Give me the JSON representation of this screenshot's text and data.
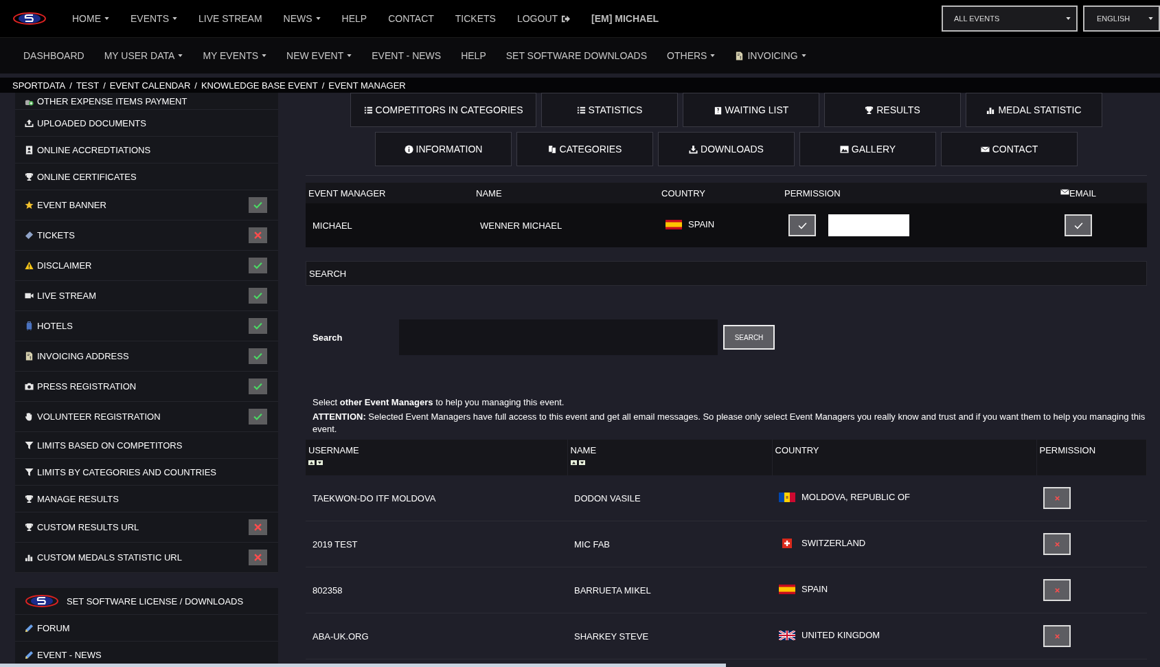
{
  "top_nav": {
    "items": [
      {
        "label": "HOME",
        "dropdown": true
      },
      {
        "label": "EVENTS",
        "dropdown": true
      },
      {
        "label": "LIVE STREAM",
        "dropdown": false
      },
      {
        "label": "NEWS",
        "dropdown": true
      },
      {
        "label": "HELP",
        "dropdown": false
      },
      {
        "label": "CONTACT",
        "dropdown": false
      },
      {
        "label": "TICKETS",
        "dropdown": false
      },
      {
        "label": "LOGOUT",
        "dropdown": false
      }
    ],
    "user": "[EM] MICHAEL",
    "event_select": "ALL EVENTS",
    "language": "ENGLISH"
  },
  "sub_nav": {
    "items": [
      {
        "label": "DASHBOARD",
        "dropdown": false
      },
      {
        "label": "MY USER DATA",
        "dropdown": true
      },
      {
        "label": "MY EVENTS",
        "dropdown": true
      },
      {
        "label": "NEW EVENT",
        "dropdown": true
      },
      {
        "label": "EVENT - NEWS",
        "dropdown": false
      },
      {
        "label": "HELP",
        "dropdown": false
      },
      {
        "label": "SET SOFTWARE DOWNLOADS",
        "dropdown": false
      },
      {
        "label": "OTHERS",
        "dropdown": true
      },
      {
        "label": "INVOICING",
        "dropdown": true
      }
    ]
  },
  "breadcrumb": [
    {
      "label": "SPORTDATA",
      "separator": "/"
    },
    {
      "label": "TEST",
      "separator": "/"
    },
    {
      "label": "EVENT CALENDAR",
      "separator": "/"
    },
    {
      "label": "KNOWLEDGE BASE EVENT",
      "separator": "/"
    },
    {
      "label": "EVENT MANAGER"
    }
  ],
  "sidebar": {
    "items": [
      {
        "label": "OTHER EXPENSE ITEMS PAYMENT"
      },
      {
        "label": "UPLOADED DOCUMENTS"
      },
      {
        "label": "ONLINE ACCREDTIATIONS"
      },
      {
        "label": "ONLINE CERTIFICATES"
      },
      {
        "label": "EVENT BANNER",
        "checked": true
      },
      {
        "label": "TICKETS",
        "checked": false
      },
      {
        "label": "DISCLAIMER",
        "checked": true
      },
      {
        "label": "LIVE STREAM",
        "checked": true
      },
      {
        "label": "HOTELS",
        "checked": true
      },
      {
        "label": "INVOICING ADDRESS",
        "checked": true
      },
      {
        "label": "PRESS REGISTRATION",
        "checked": true
      },
      {
        "label": "VOLUNTEER REGISTRATION",
        "checked": true
      },
      {
        "label": "LIMITS BASED ON COMPETITORS"
      },
      {
        "label": "LIMITS BY CATEGORIES AND COUNTRIES"
      },
      {
        "label": "MANAGE RESULTS"
      },
      {
        "label": "CUSTOM RESULTS URL",
        "checked": false
      },
      {
        "label": "CUSTOM MEDALS STATISTIC URL",
        "checked": false
      }
    ],
    "links": [
      "SET SOFTWARE LICENSE / DOWNLOADS",
      "FORUM",
      "EVENT - NEWS"
    ]
  },
  "event_tabs": [
    [
      "COMPETITORS IN CATEGORIES",
      "STATISTICS",
      "WAITING LIST",
      "RESULTS",
      "MEDAL STATISTIC"
    ],
    [
      "INFORMATION",
      "CATEGORIES",
      "DOWNLOADS",
      "GALLERY",
      "CONTACT"
    ]
  ],
  "managers_table": {
    "columns": [
      "EVENT MANAGER",
      "NAME",
      "COUNTRY",
      "PERMISSION",
      "EMAIL"
    ],
    "rows": [
      {
        "event_manager": "MICHAEL",
        "name": "WENNER MICHAEL",
        "country": "SPAIN",
        "permission": true,
        "email": true
      }
    ]
  },
  "search_panel": {
    "title": "SEARCH",
    "label": "Search",
    "button": "SEARCH"
  },
  "notice": [
    "Select **other Event Managers** to help you managing this event.",
    "**ATTENTION:** Selected Event Managers have full access to this event and get all email messages. So please only select Event Managers you really know and trust and if you want them to help you managing this event."
  ],
  "users_table": {
    "columns": [
      {
        "label": "USERNAME",
        "sortable": true
      },
      {
        "label": "NAME",
        "sortable": true
      },
      {
        "label": "COUNTRY",
        "sortable": false
      },
      {
        "label": "PERMISSION",
        "sortable": false
      }
    ],
    "rows": [
      {
        "username": "TAEKWON-DO ITF MOLDOVA",
        "name": "DODON VASILE",
        "country": "MOLDOVA, REPUBLIC OF",
        "permission": false
      },
      {
        "username": "2019 TEST",
        "name": "MIC FAB",
        "country": "SWITZERLAND",
        "permission": false
      },
      {
        "username": "802358",
        "name": "BARRUETA MIKEL",
        "country": "SPAIN",
        "permission": false
      },
      {
        "username": "ABA-UK.ORG",
        "name": "SHARKEY STEVE",
        "country": "UNITED KINGDOM",
        "permission": false
      }
    ]
  }
}
